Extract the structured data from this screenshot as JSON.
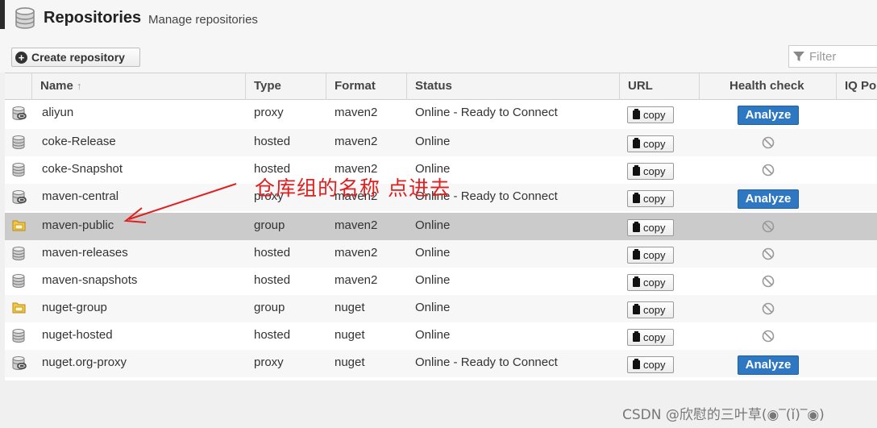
{
  "page": {
    "title": "Repositories",
    "subtitle": "Manage repositories",
    "create_label": "Create repository",
    "filter_placeholder": "Filter"
  },
  "columns": [
    "Name",
    "Type",
    "Format",
    "Status",
    "URL",
    "Health check",
    "IQ Po"
  ],
  "sort_indicator": "↑",
  "rows": [
    {
      "name": "aliyun",
      "type": "proxy",
      "format": "maven2",
      "status": "Online - Ready to Connect",
      "url": "copy",
      "health": "Analyze",
      "icon": "proxy-db-icon"
    },
    {
      "name": "coke-Release",
      "type": "hosted",
      "format": "maven2",
      "status": "Online",
      "url": "copy",
      "health": "",
      "icon": "hosted-db-icon"
    },
    {
      "name": "coke-Snapshot",
      "type": "hosted",
      "format": "maven2",
      "status": "Online",
      "url": "copy",
      "health": "",
      "icon": "hosted-db-icon"
    },
    {
      "name": "maven-central",
      "type": "proxy",
      "format": "maven2",
      "status": "Online - Ready to Connect",
      "url": "copy",
      "health": "Analyze",
      "icon": "proxy-db-icon"
    },
    {
      "name": "maven-public",
      "type": "group",
      "format": "maven2",
      "status": "Online",
      "url": "copy",
      "health": "",
      "icon": "group-folder-icon"
    },
    {
      "name": "maven-releases",
      "type": "hosted",
      "format": "maven2",
      "status": "Online",
      "url": "copy",
      "health": "",
      "icon": "hosted-db-icon"
    },
    {
      "name": "maven-snapshots",
      "type": "hosted",
      "format": "maven2",
      "status": "Online",
      "url": "copy",
      "health": "",
      "icon": "hosted-db-icon"
    },
    {
      "name": "nuget-group",
      "type": "group",
      "format": "nuget",
      "status": "Online",
      "url": "copy",
      "health": "",
      "icon": "group-folder-icon"
    },
    {
      "name": "nuget-hosted",
      "type": "hosted",
      "format": "nuget",
      "status": "Online",
      "url": "copy",
      "health": "",
      "icon": "hosted-db-icon"
    },
    {
      "name": "nuget.org-proxy",
      "type": "proxy",
      "format": "nuget",
      "status": "Online - Ready to Connect",
      "url": "copy",
      "health": "Analyze",
      "icon": "proxy-db-icon"
    }
  ],
  "annotation": "仓库组的名称 点进去",
  "watermark": "CSDN @欣慰的三叶草(◉‾(ǐ)‾◉)",
  "colors": {
    "accent": "#2e77c2",
    "annotation": "#e02020",
    "selected_row": "#cbcbcb"
  }
}
